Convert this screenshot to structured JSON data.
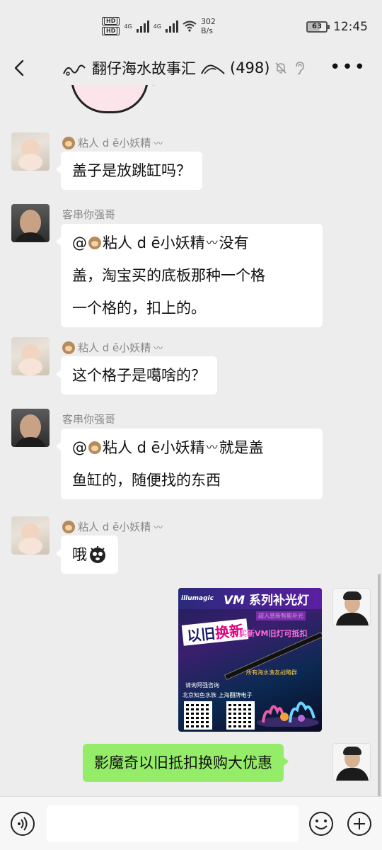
{
  "status_bar": {
    "hd1": "HD",
    "hd2": "HD",
    "sub1": "B",
    "sub2": "B",
    "net1": "4G",
    "net2": "4G",
    "speed_value": "302",
    "speed_unit": "B/s",
    "battery": "63",
    "time": "12:45"
  },
  "nav": {
    "group_title": "翻仔海水故事汇",
    "member_count": "(498)",
    "back_icon": "chevron-left-icon",
    "more_icon": "more-dots-icon"
  },
  "messages": [
    {
      "sender": "粘人 d ē小妖精",
      "text": "盖子是放跳缸吗？",
      "side": "left",
      "avatar": "baby-avatar"
    },
    {
      "sender": "客串你强哥",
      "line1": "@",
      "mention": "粘人 d ē小妖精",
      "line1_tail": " 没有",
      "line2": "盖，淘宝买的底板那种一个格",
      "line3": "一个格的，扣上的。",
      "side": "left",
      "avatar": "man-avatar"
    },
    {
      "sender": "粘人 d ē小妖精",
      "text": "这个格子是噶啥的？",
      "side": "left",
      "avatar": "baby-avatar"
    },
    {
      "sender": "客串你强哥",
      "line1": "@",
      "mention": "粘人 d ē小妖精",
      "line1_tail": " 就是盖",
      "line2": "鱼缸的，随便找的东西",
      "side": "left",
      "avatar": "man-avatar"
    },
    {
      "sender": "粘人 d ē小妖精",
      "text": "哦",
      "side": "left",
      "avatar": "baby-avatar"
    },
    {
      "type": "image",
      "side": "right",
      "avatar": "self-avatar",
      "ad": {
        "logo": "illumagic",
        "headline_vm": "VM",
        "headline": "系列补光灯",
        "sub": "超入感新智能补光",
        "swap": "以旧",
        "swap_highlight": "换新",
        "offer": "买新VM旧灯可抵扣",
        "group": "所有海水渔友战略群",
        "consult": "请询阿强咨询",
        "dealers": "北京知鱼水族  上海翻牌电子"
      }
    },
    {
      "text": "影魔奇以旧抵扣换购大优惠",
      "side": "right",
      "avatar": "self-avatar"
    }
  ],
  "input_bar": {
    "placeholder": "",
    "voice_icon": "voice-icon",
    "emoji_icon": "emoji-icon",
    "plus_icon": "plus-icon"
  }
}
